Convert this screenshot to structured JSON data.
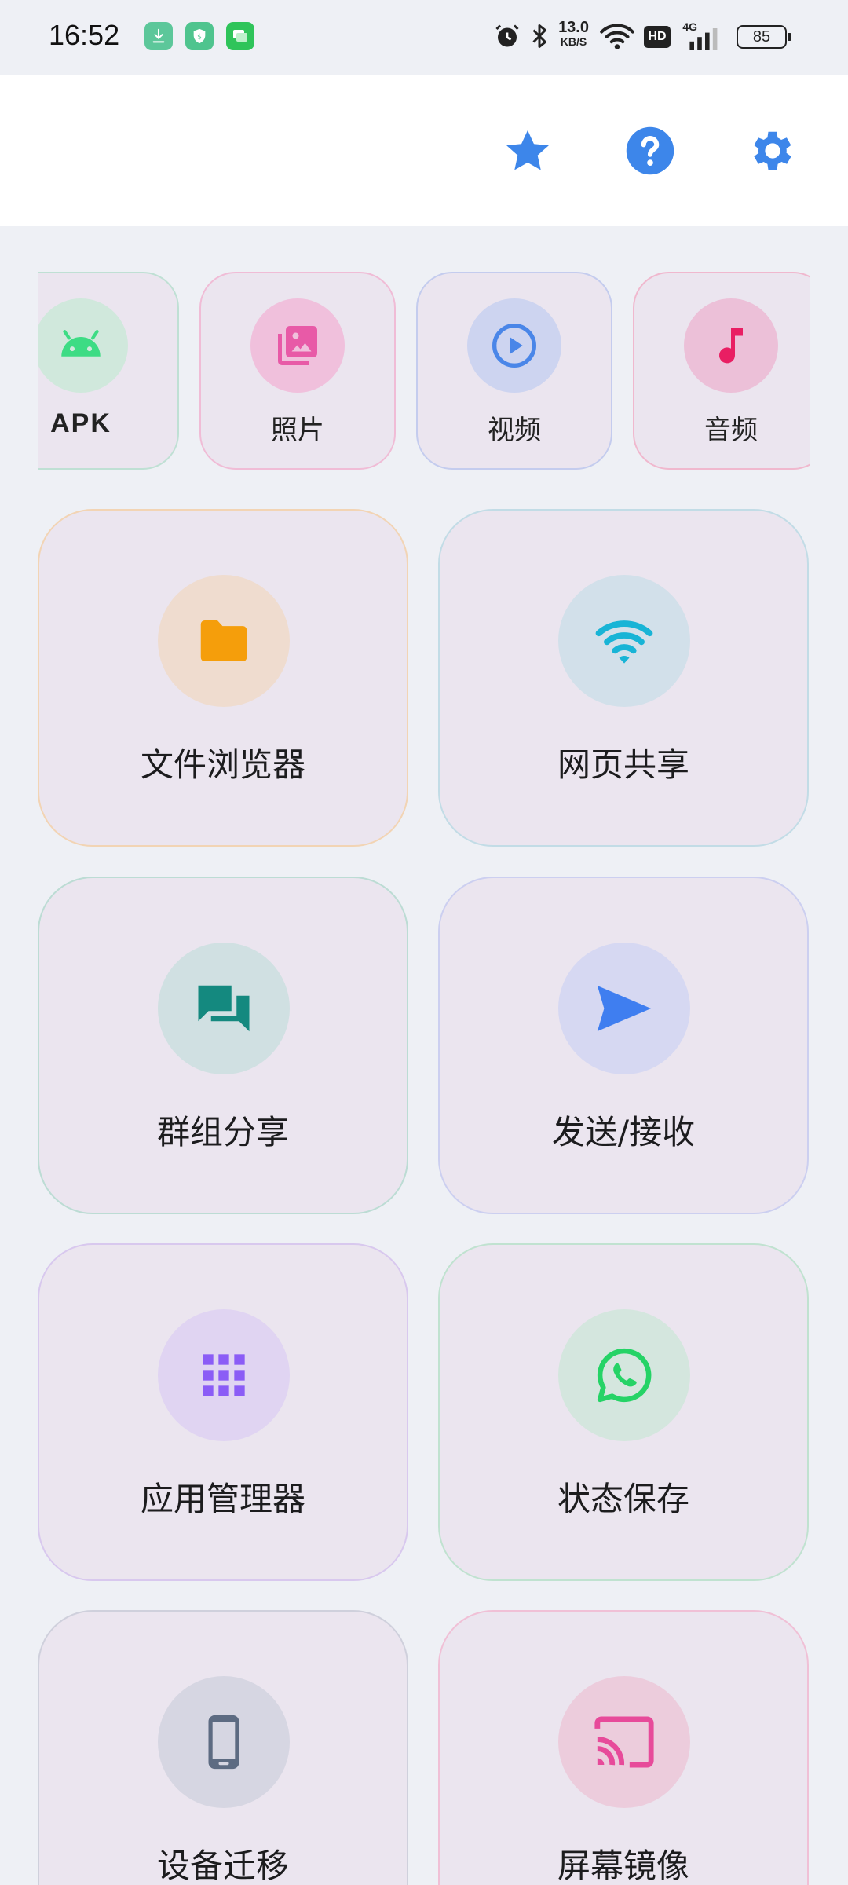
{
  "status_bar": {
    "time": "16:52",
    "net_speed_value": "13.0",
    "net_speed_unit": "KB/S",
    "hd_label": "HD",
    "network_label": "4G",
    "battery": "85"
  },
  "header": {
    "icons": [
      "star-icon",
      "help-icon",
      "gear-icon"
    ]
  },
  "categories": [
    {
      "label": "APK",
      "icon": "android-icon"
    },
    {
      "label": "照片",
      "icon": "photo-library-icon"
    },
    {
      "label": "视频",
      "icon": "play-circle-icon"
    },
    {
      "label": "音频",
      "icon": "music-note-icon"
    }
  ],
  "tiles": [
    {
      "label": "文件浏览器",
      "icon": "folder-icon"
    },
    {
      "label": "网页共享",
      "icon": "wifi-icon"
    },
    {
      "label": "群组分享",
      "icon": "forum-icon"
    },
    {
      "label": "发送/接收",
      "icon": "send-icon"
    },
    {
      "label": "应用管理器",
      "icon": "apps-grid-icon"
    },
    {
      "label": "状态保存",
      "icon": "whatsapp-icon"
    },
    {
      "label": "设备迁移",
      "icon": "smartphone-icon"
    },
    {
      "label": "屏幕镜像",
      "icon": "cast-icon"
    }
  ],
  "colors": {
    "accent_blue": "#3d86ea",
    "android_green": "#3ddc84",
    "photo_pink": "#e85aa7",
    "video_blue": "#4a86e8",
    "audio_pink": "#e91e63",
    "folder_orange": "#f59e0b",
    "wifi_cyan": "#18b4d6",
    "forum_teal": "#14897f",
    "send_blue": "#3f7ef0",
    "apps_purple": "#8b5cf6",
    "whatsapp_green": "#25d366",
    "phone_slate": "#5d6b82",
    "cast_pink": "#e74a9a"
  }
}
